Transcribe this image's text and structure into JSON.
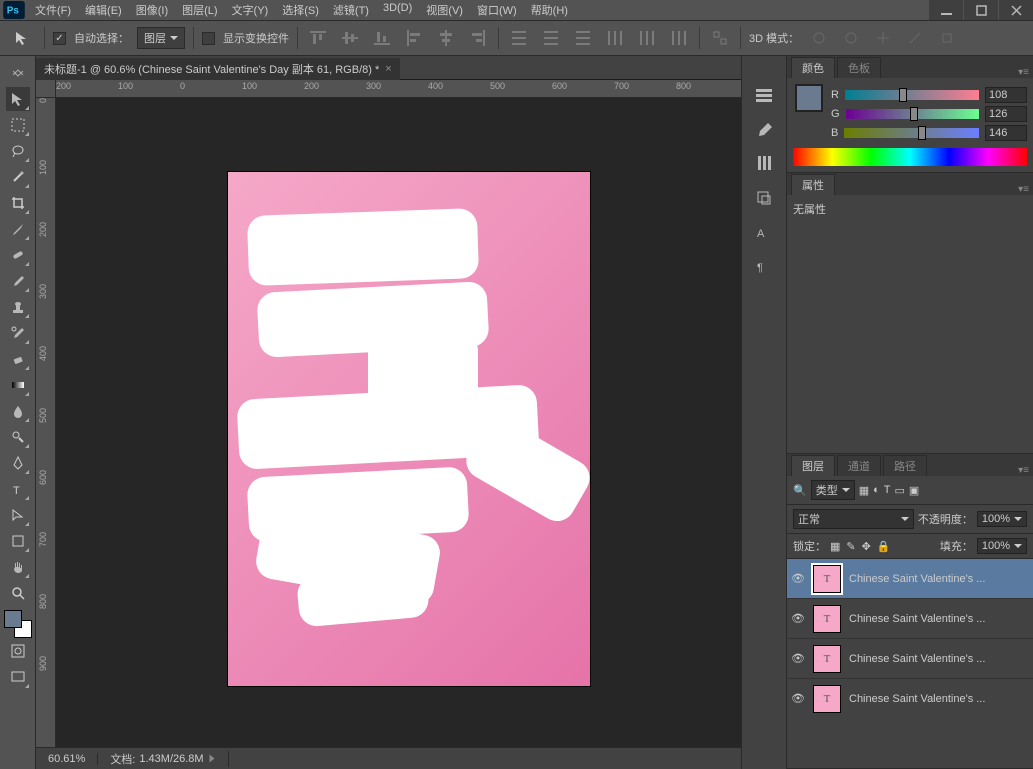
{
  "app": {
    "logo": "Ps"
  },
  "menu": {
    "file": "文件(F)",
    "edit": "编辑(E)",
    "image": "图像(I)",
    "layer": "图层(L)",
    "text": "文字(Y)",
    "select": "选择(S)",
    "filter": "滤镜(T)",
    "3d": "3D(D)",
    "view": "视图(V)",
    "window": "窗口(W)",
    "help": "帮助(H)"
  },
  "options": {
    "auto_select": "自动选择：",
    "auto_select_target": "图层",
    "show_transform": "显示变换控件",
    "mode_3d": "3D 模式："
  },
  "doc_tab": "未标题-1 @ 60.6% (Chinese  Saint  Valentine's  Day 副本 61, RGB/8) *",
  "ruler_h": [
    "200",
    "100",
    "0",
    "100",
    "200",
    "300",
    "400",
    "500",
    "600",
    "700",
    "800"
  ],
  "ruler_v": [
    "0",
    "100",
    "200",
    "300",
    "400",
    "500",
    "600",
    "700",
    "800",
    "900"
  ],
  "status": {
    "zoom": "60.61%",
    "doc_label": "文档:",
    "doc_stats": "1.43M/26.8M"
  },
  "panels": {
    "color": {
      "tab": "颜色",
      "tab2": "色板",
      "R": "R",
      "G": "G",
      "B": "B",
      "r_val": "108",
      "g_val": "126",
      "b_val": "146"
    },
    "props": {
      "tab": "属性",
      "none": "无属性"
    },
    "layers": {
      "tab": "图层",
      "tab2": "通道",
      "tab3": "路径",
      "filter_kind": "类型",
      "blend": "正常",
      "opacity_label": "不透明度：",
      "opacity": "100%",
      "lock_label": "锁定：",
      "fill_label": "填充：",
      "fill": "100%",
      "items": [
        {
          "name": "Chinese  Saint  Valentine's ...",
          "selected": true
        },
        {
          "name": "Chinese  Saint  Valentine's ...",
          "selected": false
        },
        {
          "name": "Chinese  Saint  Valentine's ...",
          "selected": false
        },
        {
          "name": "Chinese  Saint  Valentine's ...",
          "selected": false
        }
      ]
    }
  }
}
